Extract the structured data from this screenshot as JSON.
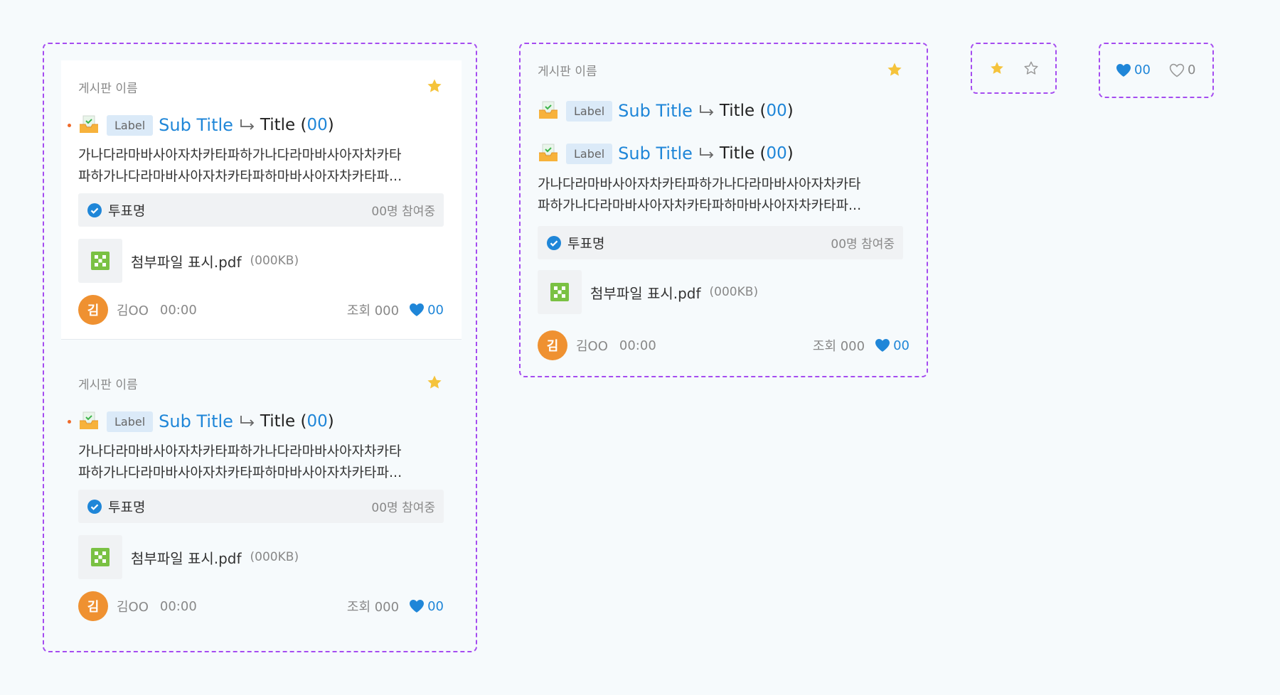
{
  "colors": {
    "accent": "#1f86d8",
    "border_dashed": "#a54cf0",
    "avatar": "#ef9131",
    "star": "#f5c33b",
    "new_dot": "#ef6a2a",
    "label_bg": "#dbeaf8"
  },
  "posts": [
    {
      "board_name": "게시판 이름",
      "label": "Label",
      "sub_title": "Sub Title",
      "title": "Title",
      "count_open": "(",
      "count": "00",
      "count_close": ")",
      "desc_line1": "가나다라마바사아자차카타파하가나다라마바사아자차카타",
      "desc_line2": "파하가나다라마바사아자차카타파하마바사아자차카타파...",
      "vote_name": "투표명",
      "vote_count": "00명 참여중",
      "file_name": "첨부파일 표시.pdf",
      "file_size": "(000KB)",
      "avatar_text": "김",
      "author": "김OO",
      "time": "00:00",
      "views": "조회 000",
      "likes": "00"
    },
    {
      "board_name": "게시판 이름",
      "label": "Label",
      "sub_title": "Sub Title",
      "title": "Title",
      "count_open": "(",
      "count": "00",
      "count_close": ")",
      "desc_line1": "가나다라마바사아자차카타파하가나다라마바사아자차카타",
      "desc_line2": "파하가나다라마바사아자차카타파하마바사아자차카타파...",
      "vote_name": "투표명",
      "vote_count": "00명 참여중",
      "file_name": "첨부파일 표시.pdf",
      "file_size": "(000KB)",
      "avatar_text": "김",
      "author": "김OO",
      "time": "00:00",
      "views": "조회 000",
      "likes": "00"
    },
    {
      "board_name": "게시판 이름",
      "label": "Label",
      "sub_title": "Sub Title",
      "title": "Title",
      "count_open": "(",
      "count": "00",
      "count_close": ")",
      "label_2": "Label",
      "sub_title_2": "Sub Title",
      "title_2": "Title",
      "count_2": "00",
      "desc_line1": "가나다라마바사아자차카타파하가나다라마바사아자차카타",
      "desc_line2": "파하가나다라마바사아자차카타파하마바사아자차카타파...",
      "vote_name": "투표명",
      "vote_count": "00명 참여중",
      "file_name": "첨부파일 표시.pdf",
      "file_size": "(000KB)",
      "avatar_text": "김",
      "author": "김OO",
      "time": "00:00",
      "views": "조회 000",
      "likes": "00"
    }
  ],
  "like_states": {
    "liked_count": "00",
    "unliked_count": "0"
  },
  "icons": {
    "favorite": "star-icon",
    "inbox": "inbox-check-icon",
    "arrow": "reply-arrow-icon",
    "vote": "check-circle-icon",
    "file": "file-thumbnail-icon",
    "like": "heart-icon"
  }
}
